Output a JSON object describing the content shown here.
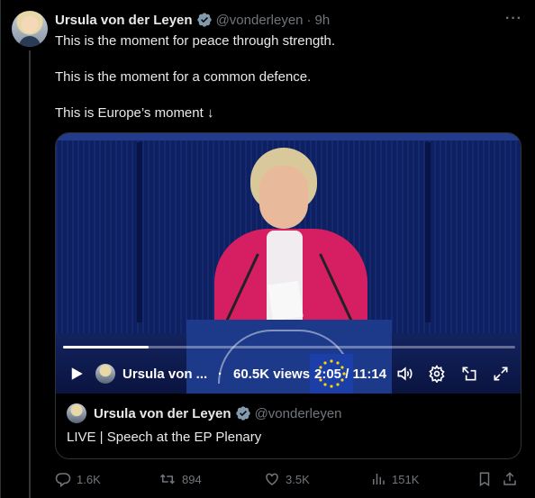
{
  "tweet": {
    "author_name": "Ursula von der Leyen",
    "handle": "@vonderleyen",
    "separator": "·",
    "time": "9h",
    "more_label": "···",
    "lines": [
      "This is the moment for peace through strength.",
      "This is the moment for a common defence.",
      "This is Europe’s moment ↓"
    ]
  },
  "video": {
    "progress": 0.19,
    "channel_label": "Ursula von ...",
    "views": "60.5K views",
    "timecode": "2:05 / 11:14"
  },
  "quoted": {
    "author_name": "Ursula von der Leyen",
    "handle": "@vonderleyen",
    "text": "LIVE | Speech at the EP Plenary"
  },
  "actions": {
    "replies": "1.6K",
    "reposts": "894",
    "likes": "3.5K",
    "views": "151K"
  },
  "colors": {
    "background": "#000000",
    "text": "#e7e9ea",
    "muted": "#71767b",
    "verified": "#829aab",
    "border": "#2f3336"
  }
}
